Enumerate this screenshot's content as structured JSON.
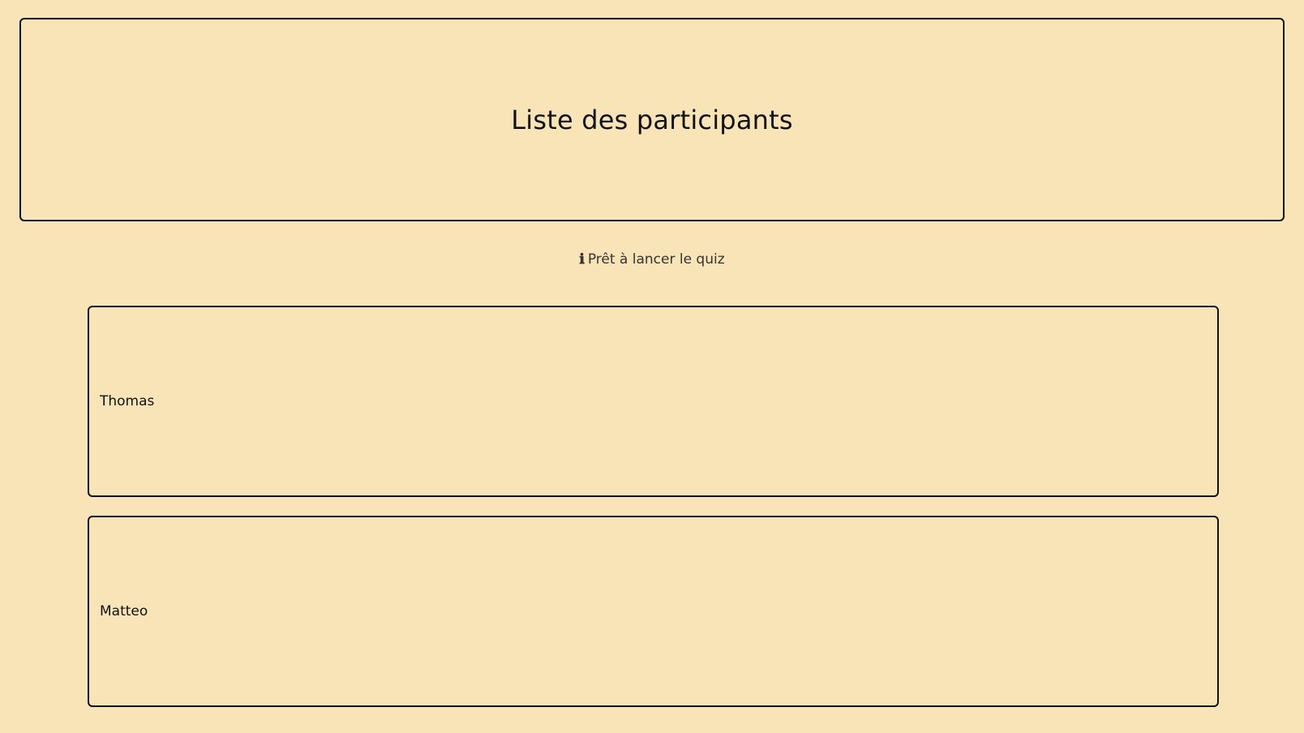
{
  "header": {
    "title": "Liste des participants"
  },
  "status": {
    "icon": "info-icon",
    "icon_glyph": "ℹ",
    "text": "Prêt à lancer le quiz"
  },
  "participants": [
    {
      "name": "Thomas"
    },
    {
      "name": "Matteo"
    }
  ],
  "colors": {
    "background": "#f9e4b7",
    "border": "#111111"
  }
}
